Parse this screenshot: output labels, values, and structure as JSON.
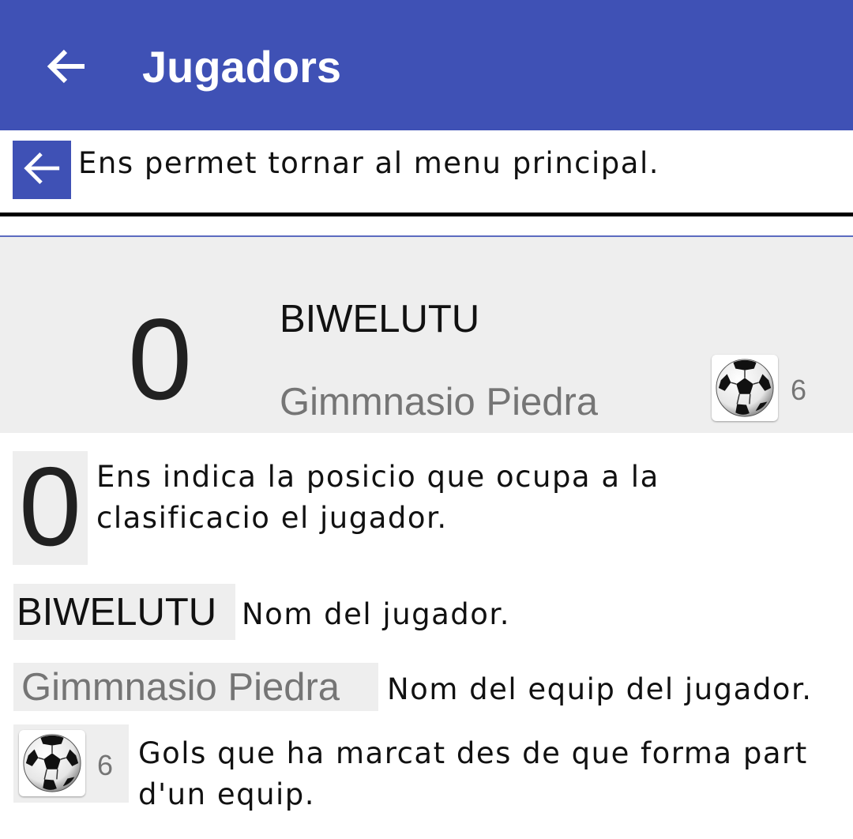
{
  "app_bar": {
    "title": "Jugadors",
    "background": "#3f51b5",
    "back_icon": "arrow-left-icon"
  },
  "help_back": {
    "icon": "arrow-left-icon",
    "text": "Ens permet tornar al menu principal."
  },
  "player_card": {
    "position": "0",
    "name": "BIWELUTU",
    "team": "Gimmnasio Piedra",
    "goals_icon": "soccer-ball-icon",
    "goals": "6"
  },
  "legend": {
    "position": {
      "sample": "0",
      "text": "Ens indica la posicio que ocupa a la clasificacio el jugador."
    },
    "name": {
      "sample": "BIWELUTU",
      "text": "Nom del jugador."
    },
    "team": {
      "sample": "Gimmnasio Piedra",
      "text": "Nom del equip del jugador."
    },
    "goals": {
      "sample": "6",
      "icon": "soccer-ball-icon",
      "text": "Gols que ha marcat des de que forma part d'un equip."
    }
  }
}
